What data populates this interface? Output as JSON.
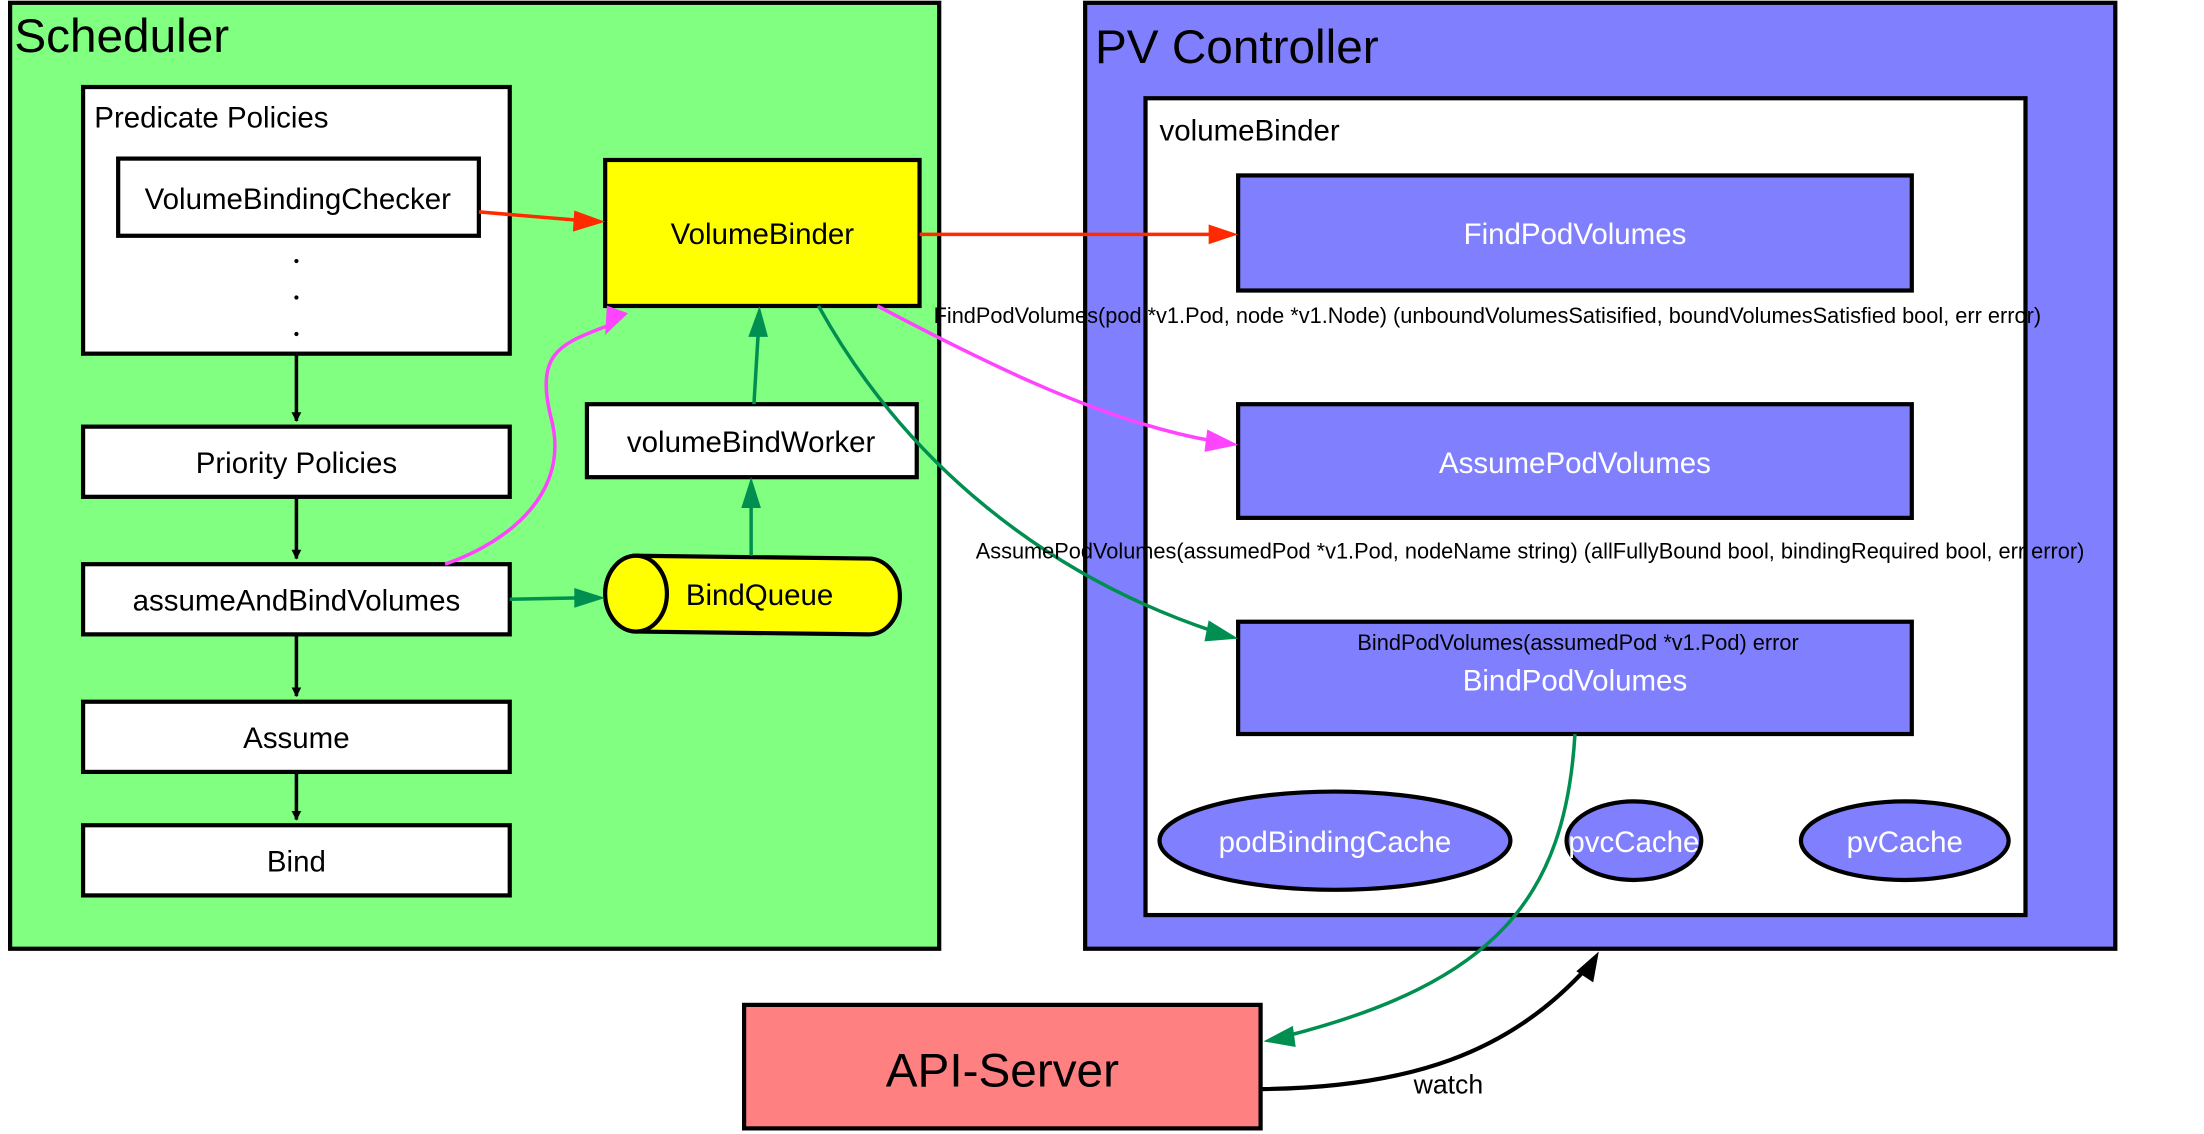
{
  "colors": {
    "scheduler_fill": "#80FF80",
    "pv_controller_fill": "#8080FF",
    "volume_binder_fill": "#FFFF00",
    "api_server_fill": "#FF8080",
    "method_fill": "#8080FF",
    "arrow_red": "#FF2A00",
    "arrow_magenta": "#FF44FF",
    "arrow_green": "#008F50",
    "arrow_black": "#000000"
  },
  "scheduler": {
    "title": "Scheduler",
    "predicate_policies": {
      "title": "Predicate Policies",
      "checker": "VolumeBindingChecker",
      "ellipsis": [
        ".",
        " .",
        "."
      ]
    },
    "volume_binder": "VolumeBinder",
    "priority_policies": "Priority Policies",
    "volume_bind_worker": "volumeBindWorker",
    "assume_and_bind_volumes": "assumeAndBindVolumes",
    "bind_queue": "BindQueue",
    "assume": "Assume",
    "bind": "Bind"
  },
  "pv_controller": {
    "title": "PV Controller",
    "volume_binder": {
      "title": "volumeBinder",
      "methods": [
        {
          "name": "FindPodVolumes",
          "signature": "FindPodVolumes(pod *v1.Pod, node *v1.Node) (unboundVolumesSatisified, boundVolumesSatisfied bool, err error)"
        },
        {
          "name": "AssumePodVolumes",
          "signature": "AssumePodVolumes(assumedPod *v1.Pod, nodeName string) (allFullyBound bool, bindingRequired bool, err error)"
        },
        {
          "name": "BindPodVolumes",
          "signature": "BindPodVolumes(assumedPod *v1.Pod) error"
        }
      ],
      "caches": [
        "podBindingCache",
        "pvcCache",
        "pvCache"
      ]
    }
  },
  "api_server": {
    "label": "API-Server",
    "watch_label": "watch"
  }
}
